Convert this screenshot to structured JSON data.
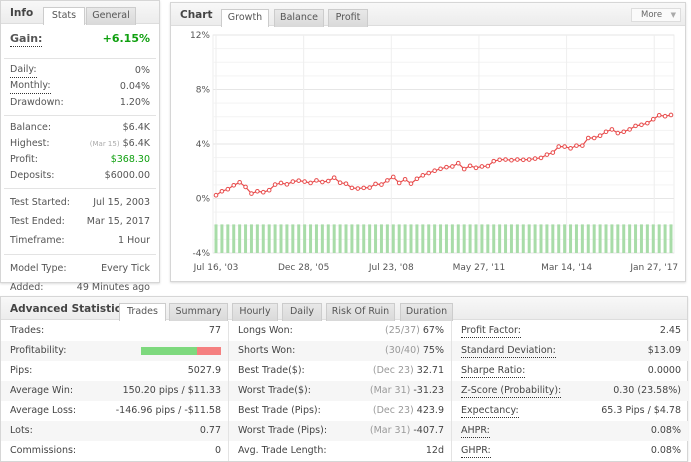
{
  "info": {
    "title": "Info",
    "tabs": [
      "Stats",
      "General"
    ],
    "gain_label": "Gain:",
    "gain_value": "+6.15%",
    "daily_label": "Daily:",
    "daily_value": "0%",
    "monthly_label": "Monthly:",
    "monthly_value": "0.04%",
    "drawdown_label": "Drawdown:",
    "drawdown_value": "1.20%",
    "balance_label": "Balance:",
    "balance_value": "$6.4K",
    "highest_label": "Highest:",
    "highest_date": "(Mar 15)",
    "highest_value": "$6.4K",
    "profit_label": "Profit:",
    "profit_value": "$368.30",
    "deposits_label": "Deposits:",
    "deposits_value": "$6000.00",
    "started_label": "Test Started:",
    "started_value": "Jul 15, 2003",
    "ended_label": "Test Ended:",
    "ended_value": "Mar 15, 2017",
    "timeframe_label": "Timeframe:",
    "timeframe_value": "1 Hour",
    "model_label": "Model Type:",
    "model_value": "Every Tick",
    "added_label": "Added:",
    "added_value": "49 Minutes ago"
  },
  "chart": {
    "title": "Chart",
    "tabs": [
      "Growth",
      "Balance",
      "Profit"
    ],
    "more": "More"
  },
  "colors": {
    "gain": "#10a010",
    "line": "#e84c4c",
    "bars": "#a8dca8",
    "profit_bar_win": "#7ed97e",
    "profit_bar_loss": "#f58080"
  },
  "chart_data": {
    "type": "line",
    "ylim": [
      -4,
      12
    ],
    "yticks": [
      "12%",
      "8%",
      "4%",
      "0%",
      "-4%"
    ],
    "ytick_values": [
      12,
      8,
      4,
      0,
      -4
    ],
    "xticks": [
      "Jul 16, '03",
      "Dec 28, '05",
      "Jul 23, '08",
      "May 27, '11",
      "Mar 14, '14",
      "Jan 27, '17"
    ],
    "grid": true,
    "series": [
      {
        "values": [
          0.24,
          0.53,
          0.68,
          0.97,
          1.19,
          0.85,
          0.36,
          0.53,
          0.46,
          0.61,
          1.02,
          1.14,
          1.04,
          1.24,
          1.31,
          1.24,
          1.14,
          1.33,
          1.21,
          1.28,
          1.53,
          1.16,
          1.09,
          0.78,
          0.73,
          0.78,
          0.8,
          1.07,
          1.02,
          1.33,
          1.58,
          1.14,
          1.41,
          1.09,
          1.45,
          1.7,
          1.87,
          2.04,
          2.18,
          2.3,
          2.35,
          2.59,
          2.16,
          2.4,
          2.25,
          2.35,
          2.38,
          2.74,
          2.84,
          2.86,
          2.81,
          2.86,
          2.84,
          2.86,
          2.93,
          2.98,
          3.22,
          3.37,
          3.81,
          3.81,
          3.68,
          3.88,
          3.88,
          4.44,
          4.44,
          4.61,
          4.9,
          5.07,
          4.8,
          4.9,
          5.07,
          5.33,
          5.41,
          5.53,
          5.82,
          6.11,
          6.04,
          6.13
        ]
      }
    ],
    "bar_level": -1.9
  },
  "adv": {
    "title": "Advanced Statistics",
    "tabs": [
      "Trades",
      "Summary",
      "Hourly",
      "Daily",
      "Risk Of Ruin",
      "Duration"
    ],
    "profitability": {
      "label": "Profitability:",
      "win_fraction": 0.7
    },
    "col1": [
      {
        "label": "Trades:",
        "value": "77"
      },
      {
        "label": "Profitability:",
        "value": ""
      },
      {
        "label": "Pips:",
        "value": "5027.9"
      },
      {
        "label": "Average Win:",
        "value": "150.20 pips / $11.33"
      },
      {
        "label": "Average Loss:",
        "value": "-146.96 pips / -$11.58"
      },
      {
        "label": "Lots:",
        "value": "0.77"
      },
      {
        "label": "Commissions:",
        "value": "0"
      }
    ],
    "col2": [
      {
        "label": "Longs Won:",
        "note": "(25/37)",
        "value": "67%"
      },
      {
        "label": "Shorts Won:",
        "note": "(30/40)",
        "value": "75%"
      },
      {
        "label": "Best Trade($):",
        "note": "(Dec 23)",
        "value": "32.71"
      },
      {
        "label": "Worst Trade($):",
        "note": "(Mar 31)",
        "value": "-31.23"
      },
      {
        "label": "Best Trade (Pips):",
        "note": "(Dec 23)",
        "value": "423.9"
      },
      {
        "label": "Worst Trade (Pips):",
        "note": "(Mar 31)",
        "value": "-407.7"
      },
      {
        "label": "Avg. Trade Length:",
        "note": "",
        "value": "12d"
      }
    ],
    "col3": [
      {
        "label": "Profit Factor:",
        "value": "2.45"
      },
      {
        "label": "Standard Deviation:",
        "value": "$13.09"
      },
      {
        "label": "Sharpe Ratio:",
        "value": "0.0000"
      },
      {
        "label": "Z-Score (Probability):",
        "value": "0.30 (23.58%)"
      },
      {
        "label": "Expectancy:",
        "value": "65.3 Pips / $4.78"
      },
      {
        "label": "AHPR:",
        "value": "0.08%"
      },
      {
        "label": "GHPR:",
        "value": "0.08%"
      }
    ]
  }
}
